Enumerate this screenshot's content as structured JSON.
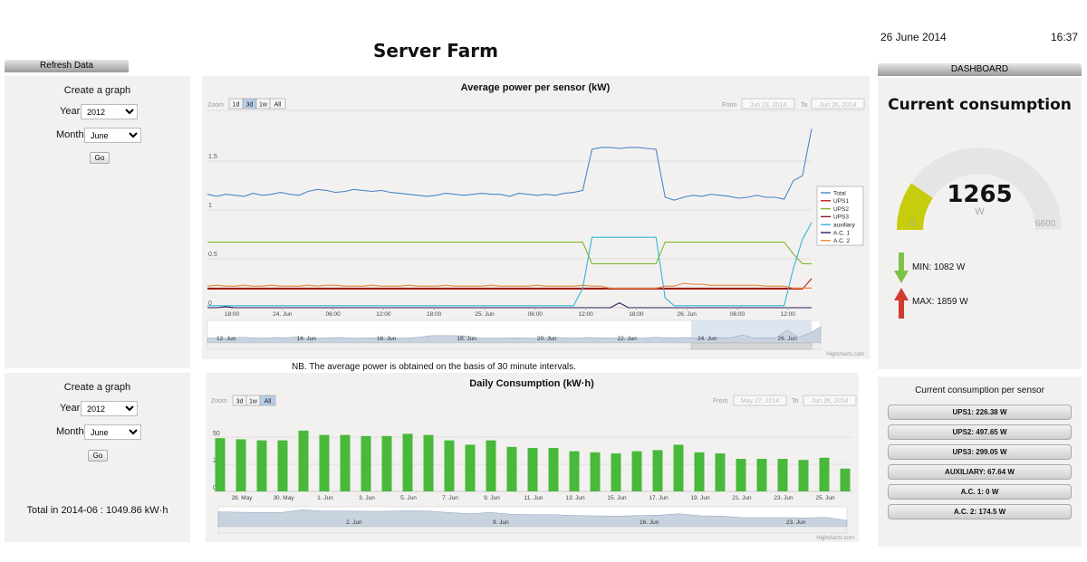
{
  "header": {
    "title": "Server Farm",
    "date": "26 June 2014",
    "time": "16:37",
    "refresh_label": "Refresh Data",
    "dashboard_label": "DASHBOARD"
  },
  "left_top": {
    "heading": "Create a graph",
    "year_label": "Year",
    "year_value": "2012",
    "month_label": "Month",
    "month_value": "June",
    "go_label": "Go"
  },
  "left_bottom": {
    "heading": "Create a graph",
    "year_label": "Year",
    "year_value": "2012",
    "month_label": "Month",
    "month_value": "June",
    "go_label": "Go",
    "total_text": "Total in 2014-06 : 1049.86 kW·h"
  },
  "power_chart": {
    "title": "Average power per sensor (kW)",
    "zoom_label": "Zoom",
    "zoom_buttons": [
      "1d",
      "3d",
      "1w",
      "All"
    ],
    "zoom_selected": "3d",
    "from_label": "From",
    "from_value": "Jun 23, 2014",
    "to_label": "To",
    "to_value": "Jun 26, 2014",
    "credit": "Highcharts.com",
    "note": "NB. The average power is obtained on the basis of 30 minute intervals."
  },
  "daily_chart": {
    "title": "Daily Consumption (kW·h)",
    "zoom_label": "Zoom",
    "zoom_buttons": [
      "3d",
      "1w",
      "All"
    ],
    "zoom_selected": "All",
    "from_label": "From",
    "from_value": "May 27, 2014",
    "to_label": "To",
    "to_value": "Jun 26, 2014",
    "credit": "Highcharts.com"
  },
  "gauge": {
    "title": "Current consumption",
    "value": "1265",
    "unit": "W",
    "min_scale": "0",
    "max_scale": "6600",
    "min_text": "MIN: 1082 W",
    "max_text": "MAX: 1859 W",
    "fraction": 0.1917,
    "color": "#c5cd0c"
  },
  "sensors": {
    "heading": "Current consumption per sensor",
    "items": [
      {
        "label": "UPS1: 226.38 W"
      },
      {
        "label": "UPS2: 497.65 W"
      },
      {
        "label": "UPS3: 299.05 W"
      },
      {
        "label": "AUXILIARY: 67.64 W"
      },
      {
        "label": "A.C. 1: 0 W"
      },
      {
        "label": "A.C. 2: 174.5 W"
      }
    ]
  },
  "chart_data": [
    {
      "type": "line",
      "title": "Average power per sensor (kW)",
      "x_labels": [
        "18:00",
        "24. Jun",
        "06:00",
        "12:00",
        "18:00",
        "25. Jun",
        "06:00",
        "12:00",
        "18:00",
        "26. Jun",
        "06:00",
        "12:00"
      ],
      "y_ticks": [
        0,
        0.5,
        1,
        1.5
      ],
      "ylim": [
        0,
        2
      ],
      "x_count": 67,
      "legend_position": "right",
      "navigator_labels": [
        "12. Jun",
        "14. Jun",
        "16. Jun",
        "18. Jun",
        "20. Jun",
        "22. Jun",
        "24. Jun",
        "26. Jun"
      ],
      "series": [
        {
          "name": "Total",
          "color": "#4a86c8",
          "values": [
            1.16,
            1.14,
            1.16,
            1.15,
            1.14,
            1.17,
            1.15,
            1.16,
            1.18,
            1.16,
            1.15,
            1.19,
            1.21,
            1.2,
            1.18,
            1.19,
            1.21,
            1.2,
            1.19,
            1.2,
            1.18,
            1.17,
            1.16,
            1.15,
            1.14,
            1.15,
            1.17,
            1.16,
            1.15,
            1.16,
            1.17,
            1.16,
            1.16,
            1.14,
            1.17,
            1.16,
            1.15,
            1.16,
            1.15,
            1.17,
            1.18,
            1.2,
            1.62,
            1.64,
            1.64,
            1.63,
            1.64,
            1.64,
            1.63,
            1.62,
            1.13,
            1.1,
            1.13,
            1.15,
            1.14,
            1.16,
            1.15,
            1.14,
            1.12,
            1.13,
            1.15,
            1.13,
            1.13,
            1.11,
            1.3,
            1.35,
            1.83
          ]
        },
        {
          "name": "UPS1",
          "color": "#c0201b",
          "values": [
            0.19,
            0.19,
            0.19,
            0.19,
            0.19,
            0.19,
            0.19,
            0.19,
            0.19,
            0.19,
            0.19,
            0.19,
            0.19,
            0.19,
            0.19,
            0.19,
            0.19,
            0.19,
            0.19,
            0.19,
            0.19,
            0.19,
            0.19,
            0.19,
            0.19,
            0.19,
            0.19,
            0.19,
            0.19,
            0.19,
            0.19,
            0.19,
            0.19,
            0.19,
            0.19,
            0.19,
            0.19,
            0.19,
            0.19,
            0.19,
            0.19,
            0.19,
            0.19,
            0.19,
            0.19,
            0.19,
            0.19,
            0.19,
            0.19,
            0.19,
            0.19,
            0.19,
            0.19,
            0.19,
            0.19,
            0.19,
            0.19,
            0.19,
            0.19,
            0.19,
            0.19,
            0.19,
            0.19,
            0.19,
            0.19,
            0.19,
            0.3
          ]
        },
        {
          "name": "UPS2",
          "color": "#7cbb2f",
          "values": [
            0.67,
            0.67,
            0.67,
            0.67,
            0.67,
            0.67,
            0.67,
            0.67,
            0.67,
            0.67,
            0.67,
            0.67,
            0.67,
            0.67,
            0.67,
            0.67,
            0.67,
            0.67,
            0.67,
            0.67,
            0.67,
            0.67,
            0.67,
            0.67,
            0.67,
            0.67,
            0.67,
            0.67,
            0.67,
            0.67,
            0.67,
            0.67,
            0.67,
            0.67,
            0.67,
            0.67,
            0.67,
            0.67,
            0.67,
            0.67,
            0.67,
            0.67,
            0.45,
            0.45,
            0.45,
            0.45,
            0.45,
            0.45,
            0.45,
            0.45,
            0.67,
            0.67,
            0.67,
            0.67,
            0.67,
            0.67,
            0.67,
            0.67,
            0.67,
            0.67,
            0.67,
            0.67,
            0.67,
            0.67,
            0.55,
            0.45,
            0.45
          ]
        },
        {
          "name": "UPS3",
          "color": "#8b1a1a",
          "values": [
            0.2,
            0.2,
            0.2,
            0.2,
            0.2,
            0.2,
            0.2,
            0.2,
            0.2,
            0.2,
            0.2,
            0.2,
            0.2,
            0.2,
            0.2,
            0.2,
            0.2,
            0.2,
            0.2,
            0.2,
            0.2,
            0.2,
            0.2,
            0.2,
            0.2,
            0.2,
            0.2,
            0.2,
            0.2,
            0.2,
            0.2,
            0.2,
            0.2,
            0.2,
            0.2,
            0.2,
            0.2,
            0.2,
            0.2,
            0.2,
            0.2,
            0.2,
            0.2,
            0.2,
            0.2,
            0.2,
            0.2,
            0.2,
            0.2,
            0.2,
            0.2,
            0.2,
            0.2,
            0.2,
            0.2,
            0.2,
            0.2,
            0.2,
            0.2,
            0.2,
            0.2,
            0.2,
            0.2,
            0.2,
            0.2,
            0.2,
            0.2
          ]
        },
        {
          "name": "auxiliary",
          "color": "#32b6d8",
          "values": [
            0.02,
            0.02,
            0.02,
            0.02,
            0.02,
            0.02,
            0.02,
            0.02,
            0.02,
            0.02,
            0.02,
            0.02,
            0.02,
            0.02,
            0.02,
            0.02,
            0.02,
            0.02,
            0.02,
            0.02,
            0.02,
            0.02,
            0.02,
            0.02,
            0.02,
            0.02,
            0.02,
            0.02,
            0.02,
            0.02,
            0.02,
            0.02,
            0.02,
            0.02,
            0.02,
            0.02,
            0.02,
            0.02,
            0.02,
            0.02,
            0.02,
            0.2,
            0.72,
            0.72,
            0.72,
            0.72,
            0.72,
            0.72,
            0.72,
            0.72,
            0.1,
            0.02,
            0.02,
            0.02,
            0.02,
            0.02,
            0.02,
            0.02,
            0.02,
            0.02,
            0.02,
            0.02,
            0.02,
            0.02,
            0.4,
            0.7,
            0.87
          ]
        },
        {
          "name": "A.C. 1",
          "color": "#2b1a5e",
          "values": [
            0,
            0,
            0.01,
            0,
            0,
            0,
            0,
            0,
            0,
            0,
            0,
            0,
            0,
            0,
            0,
            0,
            0,
            0,
            0,
            0,
            0,
            0,
            0,
            0,
            0,
            0,
            0,
            0,
            0,
            0,
            0,
            0,
            0,
            0,
            0,
            0,
            0,
            0,
            0,
            0,
            0,
            0,
            0,
            0,
            0,
            0.05,
            0,
            0,
            0,
            0,
            0,
            0,
            0,
            0,
            0,
            0,
            0,
            0,
            0,
            0,
            0,
            0,
            0,
            0,
            0,
            0,
            0
          ]
        },
        {
          "name": "A.C. 2",
          "color": "#e8883c",
          "values": [
            0.22,
            0.23,
            0.22,
            0.22,
            0.23,
            0.22,
            0.22,
            0.23,
            0.22,
            0.22,
            0.22,
            0.23,
            0.22,
            0.23,
            0.23,
            0.22,
            0.22,
            0.22,
            0.23,
            0.22,
            0.22,
            0.22,
            0.23,
            0.22,
            0.22,
            0.22,
            0.23,
            0.22,
            0.22,
            0.22,
            0.22,
            0.23,
            0.22,
            0.22,
            0.22,
            0.22,
            0.23,
            0.22,
            0.22,
            0.22,
            0.22,
            0.23,
            0.22,
            0.22,
            0.2,
            0.2,
            0.2,
            0.2,
            0.2,
            0.2,
            0.22,
            0.22,
            0.25,
            0.24,
            0.24,
            0.23,
            0.23,
            0.23,
            0.23,
            0.23,
            0.23,
            0.22,
            0.22,
            0.22,
            0.2,
            0.2,
            0.2
          ]
        }
      ]
    },
    {
      "type": "bar",
      "title": "Daily Consumption (kW·h)",
      "y_ticks": [
        0,
        25,
        50
      ],
      "ylim": [
        0,
        65
      ],
      "x_labels": [
        "28. May",
        "30. May",
        "1. Jun",
        "3. Jun",
        "5. Jun",
        "7. Jun",
        "9. Jun",
        "11. Jun",
        "13. Jun",
        "15. Jun",
        "17. Jun",
        "19. Jun",
        "21. Jun",
        "23. Jun",
        "25. Jun"
      ],
      "values": [
        49,
        48,
        47,
        47,
        56,
        52,
        52,
        51,
        51,
        53,
        52,
        47,
        43,
        47,
        41,
        40,
        40,
        37,
        36,
        35,
        37,
        38,
        43,
        36,
        35,
        30,
        30,
        30,
        29,
        31,
        21
      ],
      "color": "#48b93a",
      "navigator_labels": [
        "2. Jun",
        "9. Jun",
        "16. Jun",
        "23. Jun"
      ]
    }
  ]
}
